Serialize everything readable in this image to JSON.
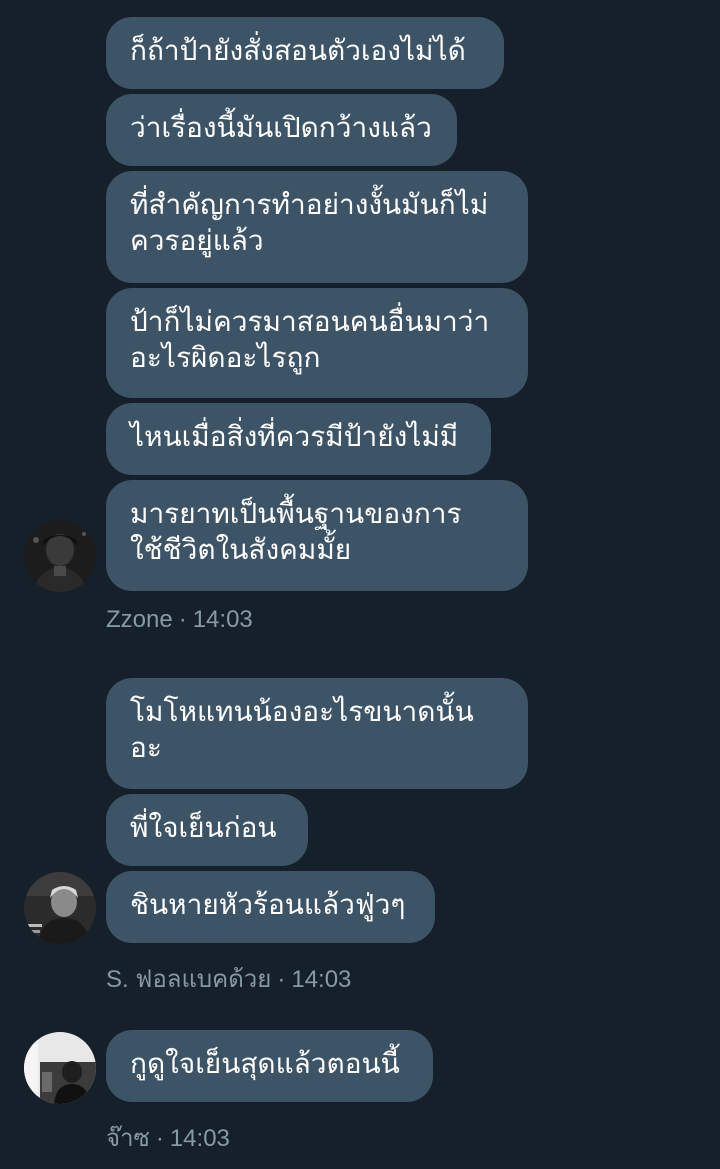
{
  "conversation": {
    "groups": [
      {
        "sender": "Zzone",
        "time": "14:03",
        "messages": [
          "ก็ถ้าป้ายังสั่งสอนตัวเองไม่ได้",
          "ว่าเรื่องนี้มันเปิดกว้างแล้ว",
          "ที่สำคัญการทำอย่างงั้นมันก็ไม่\nควรอยู่แล้ว",
          "ป้าก็ไม่ควรมาสอนคนอื่นมาว่า\nอะไรผิดอะไรถูก",
          "ไหนเมื่อสิ่งที่ควรมีป้ายังไม่มี",
          "มารยาทเป็นพื้นฐานของการ\nใช้ชีวิตในสังคมมั้ย"
        ]
      },
      {
        "sender": "S. ฟอลแบคด้วย",
        "time": "14:03",
        "messages": [
          "โมโหแทนน้องอะไรขนาดนั้น\nอะ",
          "พี่ใจเย็นก่อน",
          "ชินหายหัวร้อนแล้วฟู่วๆ"
        ]
      },
      {
        "sender": "จ๊าซ",
        "time": "14:03",
        "messages": [
          "กูดูใจเย็นสุดแล้วตอนนี้"
        ]
      }
    ],
    "separator": "·"
  },
  "colors": {
    "background": "#15202b",
    "bubble": "#3d5467",
    "bubble_text": "#ffffff",
    "meta_text": "#8899a6"
  }
}
